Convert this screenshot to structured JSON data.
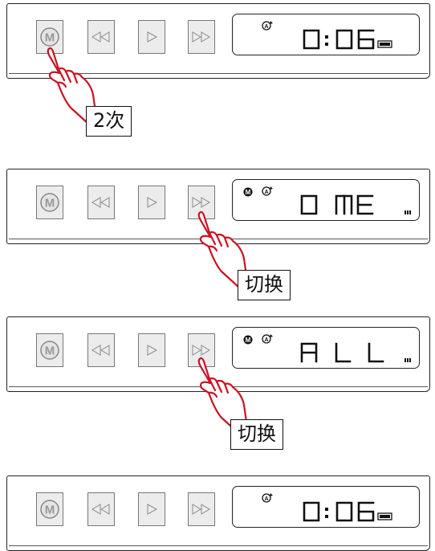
{
  "steps": [
    {
      "display_mode": "time",
      "m_indicator": false,
      "battery": "full",
      "callout": "2次",
      "pointing_at": "m-button"
    },
    {
      "display_mode": "text",
      "text": "ONE",
      "m_indicator": true,
      "battery": "low",
      "callout": "切换",
      "pointing_at": "next-button"
    },
    {
      "display_mode": "text",
      "text": "ALL",
      "m_indicator": true,
      "battery": "low",
      "callout": "切换",
      "pointing_at": "next-button"
    },
    {
      "display_mode": "time",
      "m_indicator": false,
      "battery": "full"
    }
  ],
  "time": "0:06",
  "buttons": {
    "mode": {
      "label": "M",
      "icon": "m-circle-icon"
    },
    "prev": {
      "icon": "double-left-triangle-icon"
    },
    "play": {
      "icon": "right-triangle-icon"
    },
    "next": {
      "icon": "double-right-triangle-icon"
    }
  },
  "icons": {
    "repeat": "circled-a-repeat-icon",
    "mode_dot": "filled-m-circle-icon",
    "battery": "battery-icon",
    "hand": "pointing-hand-icon"
  },
  "colors": {
    "hand_outline": "#cc1122",
    "button_fill": "#ececec",
    "button_border": "#777777",
    "outline": "#222222"
  }
}
